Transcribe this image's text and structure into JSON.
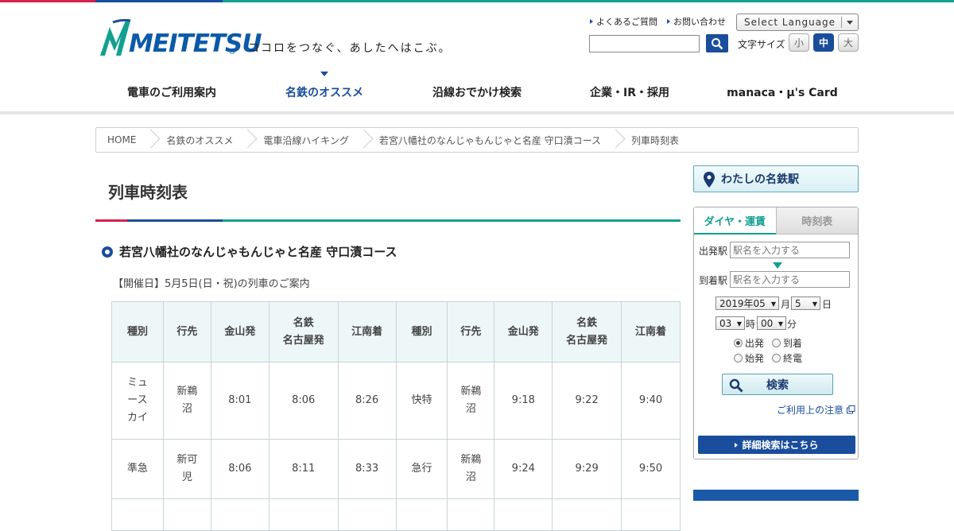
{
  "brand": {
    "logo_text": "MEITETSU",
    "registered": "®",
    "tagline": "ココロをつなぐ、あしたへはこぶ。"
  },
  "header": {
    "links": [
      "よくあるご質問",
      "お問い合わせ"
    ],
    "language_label": "Select Language",
    "font_size_label": "文字サイズ",
    "font_sizes": [
      "小",
      "中",
      "大"
    ]
  },
  "nav": {
    "items": [
      "電車のご利用案内",
      "名鉄のオススメ",
      "沿線おでかけ検索",
      "企業・IR・採用",
      "manaca・μ's Card"
    ],
    "active": 1
  },
  "breadcrumb": [
    "HOME",
    "名鉄のオススメ",
    "電車沿線ハイキング",
    "若宮八幡社のなんじゃもんじゃと名産 守口漬コース",
    "列車時刻表"
  ],
  "main": {
    "title": "列車時刻表",
    "subtitle": "若宮八幡社のなんじゃもんじゃと名産 守口漬コース",
    "note": "【開催日】5月5日(日・祝)の列車のご案内",
    "table": {
      "headers": [
        "種別",
        "行先",
        "金山発",
        "名鉄\n名古屋発",
        "江南着",
        "種別",
        "行先",
        "金山発",
        "名鉄\n名古屋発",
        "江南着"
      ],
      "rows": [
        [
          "ミュースカイ",
          "新鵜沼",
          "8:01",
          "8:06",
          "8:26",
          "快特",
          "新鵜沼",
          "9:18",
          "9:22",
          "9:40"
        ],
        [
          "準急",
          "新可児",
          "8:06",
          "8:11",
          "8:33",
          "急行",
          "新鵜沼",
          "9:24",
          "9:29",
          "9:50"
        ],
        [
          "",
          "",
          "",
          "",
          "",
          "",
          "",
          "",
          "",
          ""
        ]
      ]
    }
  },
  "sidebar": {
    "my_station": "わたしの名鉄駅",
    "tabs": [
      "ダイヤ・運賃",
      "時刻表"
    ],
    "from_label": "出発駅",
    "from_placeholder": "駅名を入力する",
    "to_label": "到着駅",
    "to_placeholder": "駅名を入力する",
    "year_month": "2019年05",
    "month_unit": "月",
    "day": "5",
    "day_unit": "日",
    "hour": "03",
    "hour_unit": "時",
    "minute": "00",
    "minute_unit": "分",
    "radios": [
      "出発",
      "到着",
      "始発",
      "終電"
    ],
    "radio_selected": 0,
    "search_label": "検索",
    "notice_label": "ご利用上の注意",
    "advanced_label": "詳細検索はこちら"
  },
  "colors": {
    "accent_blue": "#1a4d9c",
    "accent_teal": "#12a08f",
    "accent_red": "#d6224c"
  }
}
